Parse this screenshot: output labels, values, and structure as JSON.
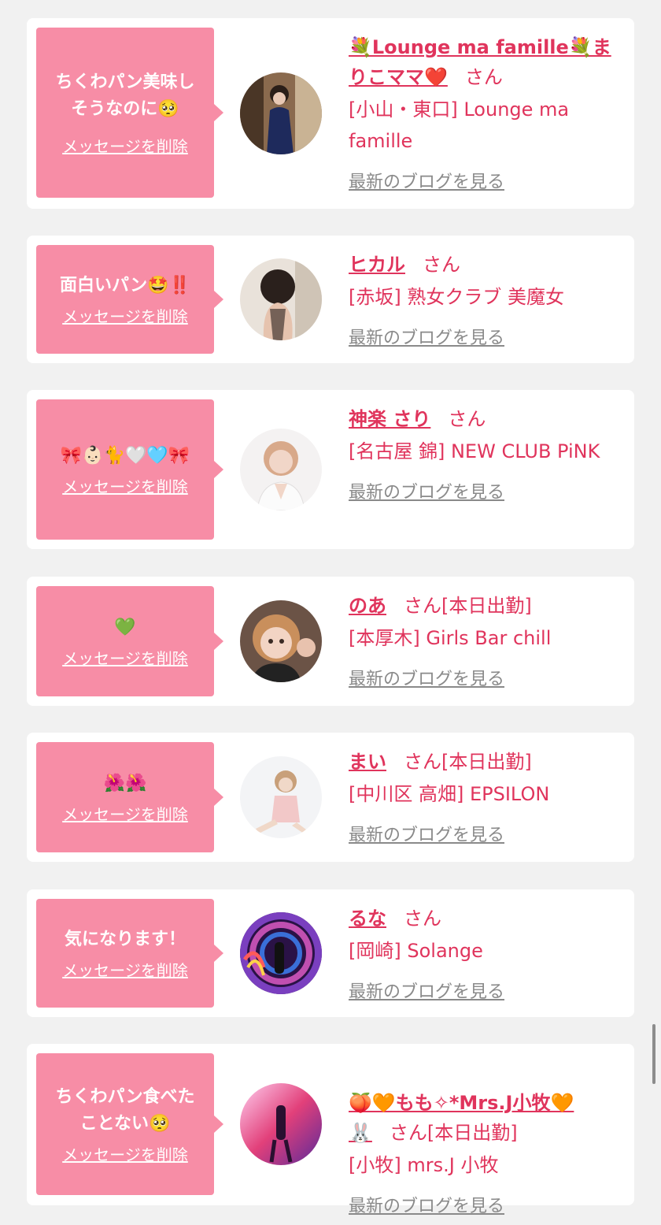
{
  "theme": {
    "accent": "#e0345c",
    "bubble": "#f78da6",
    "muted": "#8a8a8a",
    "background": "#f1f1f1"
  },
  "cards": [
    {
      "message": "ちくわパン美味し\nそうなのに🥺",
      "delete_label": "メッセージを削除",
      "name": "💐Lounge ma famille💐まりこママ❤️",
      "san": "さん",
      "status": "",
      "shop": "[小山・東口] Lounge ma famille",
      "blog_label": "最新のブログを見る",
      "avatar_icon": "woman-kimono-photo"
    },
    {
      "message": "面白いパン🤩‼️",
      "delete_label": "メッセージを削除",
      "name": "ヒカル",
      "san": "さん",
      "status": "",
      "shop": "[赤坂] 熟女クラブ 美魔女",
      "blog_label": "最新のブログを見る",
      "avatar_icon": "woman-back-photo"
    },
    {
      "message": "🎀👶🏻🐈🤍🩵🎀",
      "delete_label": "メッセージを削除",
      "name": "神楽 さり",
      "san": "さん",
      "status": "",
      "shop": "[名古屋 錦] NEW CLUB PiNK",
      "blog_label": "最新のブログを見る",
      "avatar_icon": "woman-portrait-photo"
    },
    {
      "message": "💚",
      "delete_label": "メッセージを削除",
      "name": "のあ",
      "san": "さん",
      "status": "[本日出勤]",
      "shop": "[本厚木] Girls Bar chill",
      "blog_label": "最新のブログを見る",
      "avatar_icon": "woman-selfie-photo"
    },
    {
      "message": "🌺🌺",
      "delete_label": "メッセージを削除",
      "name": "まい",
      "san": "さん",
      "status": "[本日出勤]",
      "shop": "[中川区 高畑] EPSILON",
      "blog_label": "最新のブログを見る",
      "avatar_icon": "woman-sitting-photo"
    },
    {
      "message": "気になります！",
      "delete_label": "メッセージを削除",
      "name": "るな",
      "san": "さん",
      "status": "",
      "shop": "[岡崎] Solange",
      "blog_label": "最新のブログを見る",
      "avatar_icon": "light-tunnel-photo"
    },
    {
      "message": "ちくわパン食べた\nことない🥺",
      "delete_label": "メッセージを削除",
      "name": "🍑🧡もも✧*Mrs.J小牧🧡\n🐰",
      "san": "さん",
      "status": "[本日出勤]",
      "shop": "[小牧] mrs.J 小牧",
      "blog_label": "最新のブログを見る",
      "avatar_icon": "woman-neon-photo"
    }
  ]
}
